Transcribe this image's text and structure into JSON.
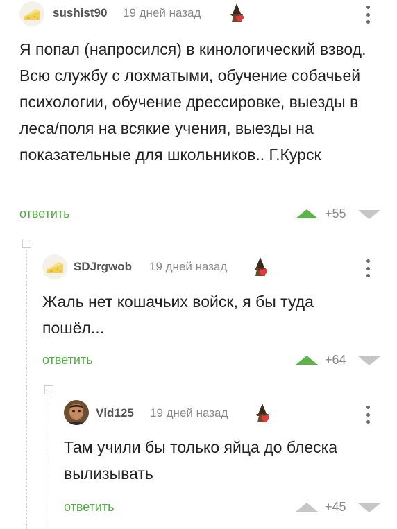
{
  "colors": {
    "accent": "#4fae3f",
    "vote_up": "#5bb34a",
    "vote_neutral": "#c6c6c6"
  },
  "comments": [
    {
      "username": "sushist90",
      "timestamp": "19 дней назад",
      "avatar": "cheese-avatar",
      "badge": "wizard-badge-icon",
      "text": "Я попал (напросился) в кинологический взвод. Всю службу с лохматыми, обучение собачьей психологии, обучение дрессировке, выезды в леса/поля на всякие учения, выезды на показательные для школьников.. Г.Курск",
      "reply_label": "ответить",
      "rating": "+55"
    },
    {
      "username": "SDJrgwob",
      "timestamp": "19 дней назад",
      "avatar": "cheese-avatar",
      "badge": "wizard-badge-icon",
      "text": "Жаль нет кошачьих войск, я бы туда пошёл...",
      "reply_label": "ответить",
      "rating": "+64"
    },
    {
      "username": "Vld125",
      "timestamp": "19 дней назад",
      "avatar": "man-photo-avatar",
      "badge": "wizard-badge-icon",
      "text": "Там учили бы только яйца до блеска вылизывать",
      "reply_label": "ответить",
      "rating": "+45"
    }
  ]
}
